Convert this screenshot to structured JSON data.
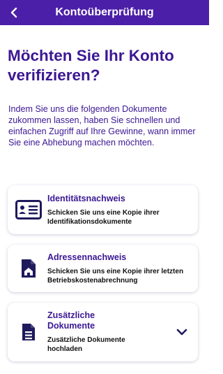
{
  "header": {
    "title": "Kontoüberprüfung",
    "back_icon": "chevron-left-icon"
  },
  "main": {
    "title": "Möchten Sie Ihr Konto verifizieren?",
    "intro": "Indem Sie uns die folgenden Dokumente zukommen lassen, haben Sie schnellen und einfachen Zugriff auf Ihre Gewinne, wann immer Sie eine Abhebung machen möchten."
  },
  "cards": [
    {
      "icon": "id-card-icon",
      "title": "Identitätsnachweis",
      "description": "Schicken Sie uns eine Kopie ihrer Identifikationsdokumente"
    },
    {
      "icon": "home-document-icon",
      "title": "Adressennachweis",
      "description": "Schicken Sie uns eine Kopie ihrer letzten Betriebskostenabrechnung"
    },
    {
      "icon": "document-icon",
      "title": "Zusätzliche Dokumente",
      "description": "Zusätzliche Dokumente hochladen",
      "expand_icon": "chevron-down-icon"
    }
  ],
  "colors": {
    "primary": "#4b1fa8",
    "text": "#3b1793"
  }
}
